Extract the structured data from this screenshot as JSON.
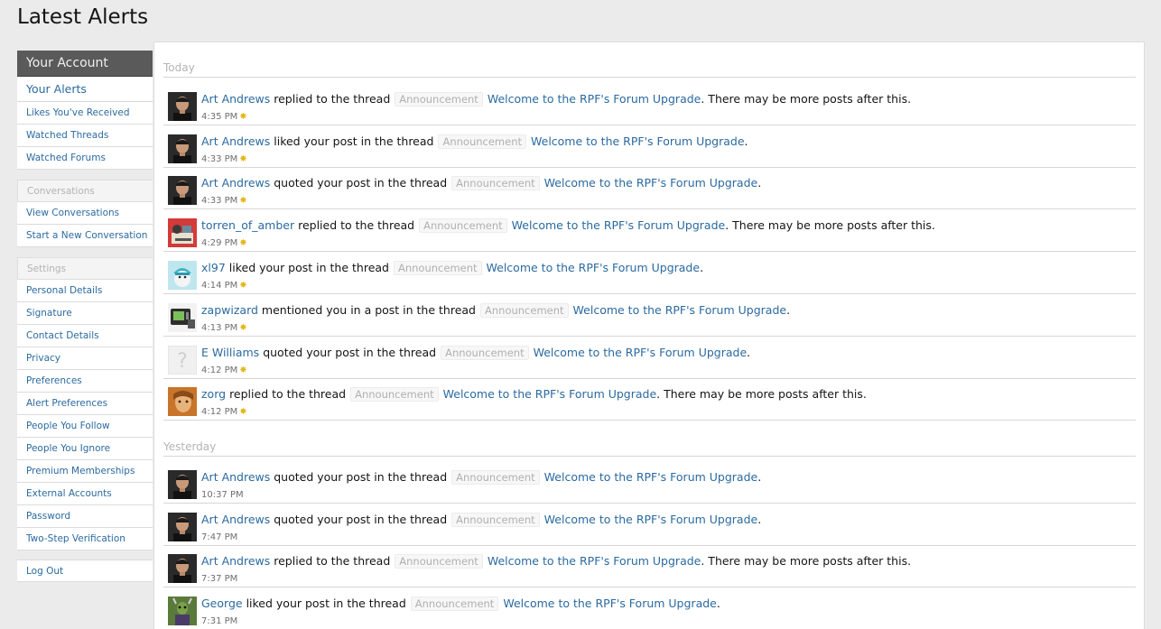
{
  "page": {
    "title": "Latest Alerts"
  },
  "sidebar": {
    "header": "Your Account",
    "current": "Your Alerts",
    "group1": [
      "Likes You've Received",
      "Watched Threads",
      "Watched Forums"
    ],
    "conversations_label": "Conversations",
    "group2": [
      "View Conversations",
      "Start a New Conversation"
    ],
    "settings_label": "Settings",
    "group3": [
      "Personal Details",
      "Signature",
      "Contact Details",
      "Privacy",
      "Preferences",
      "Alert Preferences",
      "People You Follow",
      "People You Ignore",
      "Premium Memberships",
      "External Accounts",
      "Password",
      "Two-Step Verification"
    ],
    "logout": "Log Out"
  },
  "days": [
    {
      "label": "Today",
      "alerts": [
        {
          "user": "Art Andrews",
          "action": "replied to the thread",
          "prefix": "Announcement",
          "thread": "Welcome to the RPF's Forum Upgrade",
          "suffix": ". There may be more posts after this.",
          "time": "4:35 PM",
          "new": true,
          "avatar": "art"
        },
        {
          "user": "Art Andrews",
          "action": "liked your post in the thread",
          "prefix": "Announcement",
          "thread": "Welcome to the RPF's Forum Upgrade",
          "suffix": ".",
          "time": "4:33 PM",
          "new": true,
          "avatar": "art"
        },
        {
          "user": "Art Andrews",
          "action": "quoted your post in the thread",
          "prefix": "Announcement",
          "thread": "Welcome to the RPF's Forum Upgrade",
          "suffix": ".",
          "time": "4:33 PM",
          "new": true,
          "avatar": "art"
        },
        {
          "user": "torren_of_amber",
          "action": "replied to the thread",
          "prefix": "Announcement",
          "thread": "Welcome to the RPF's Forum Upgrade",
          "suffix": ". There may be more posts after this.",
          "time": "4:29 PM",
          "new": true,
          "avatar": "torren"
        },
        {
          "user": "xl97",
          "action": "liked your post in the thread",
          "prefix": "Announcement",
          "thread": "Welcome to the RPF's Forum Upgrade",
          "suffix": ".",
          "time": "4:14 PM",
          "new": true,
          "avatar": "xl97"
        },
        {
          "user": "zapwizard",
          "action": "mentioned you in a post in the thread",
          "prefix": "Announcement",
          "thread": "Welcome to the RPF's Forum Upgrade",
          "suffix": ".",
          "time": "4:13 PM",
          "new": true,
          "avatar": "zap"
        },
        {
          "user": "E Williams",
          "action": "quoted your post in the thread",
          "prefix": "Announcement",
          "thread": "Welcome to the RPF's Forum Upgrade",
          "suffix": ".",
          "time": "4:12 PM",
          "new": true,
          "avatar": "default"
        },
        {
          "user": "zorg",
          "action": "replied to the thread",
          "prefix": "Announcement",
          "thread": "Welcome to the RPF's Forum Upgrade",
          "suffix": ". There may be more posts after this.",
          "time": "4:12 PM",
          "new": true,
          "avatar": "zorg"
        }
      ]
    },
    {
      "label": "Yesterday",
      "alerts": [
        {
          "user": "Art Andrews",
          "action": "quoted your post in the thread",
          "prefix": "Announcement",
          "thread": "Welcome to the RPF's Forum Upgrade",
          "suffix": ".",
          "time": "10:37 PM",
          "new": false,
          "avatar": "art"
        },
        {
          "user": "Art Andrews",
          "action": "quoted your post in the thread",
          "prefix": "Announcement",
          "thread": "Welcome to the RPF's Forum Upgrade",
          "suffix": ".",
          "time": "7:47 PM",
          "new": false,
          "avatar": "art"
        },
        {
          "user": "Art Andrews",
          "action": "replied to the thread",
          "prefix": "Announcement",
          "thread": "Welcome to the RPF's Forum Upgrade",
          "suffix": ". There may be more posts after this.",
          "time": "7:37 PM",
          "new": false,
          "avatar": "art"
        },
        {
          "user": "George",
          "action": "liked your post in the thread",
          "prefix": "Announcement",
          "thread": "Welcome to the RPF's Forum Upgrade",
          "suffix": ".",
          "time": "7:31 PM",
          "new": false,
          "avatar": "george"
        }
      ]
    }
  ],
  "colors": {
    "link": "#2b6aa0",
    "new_icon": "#e3b81a",
    "sidebar_header": "#5a5a5a"
  },
  "icons": {
    "new_alert": "asterisk-icon"
  }
}
